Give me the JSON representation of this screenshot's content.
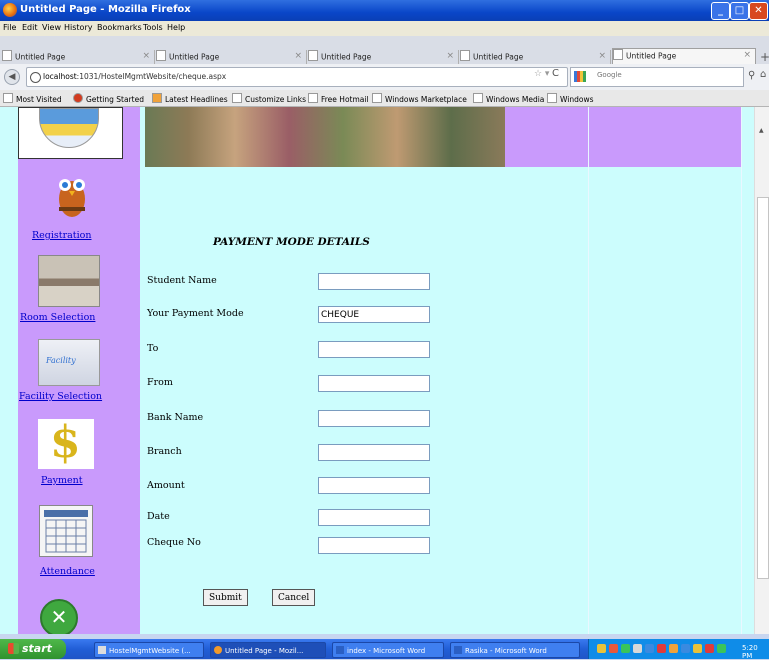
{
  "window": {
    "title": "Untitled Page - Mozilla Firefox"
  },
  "menu": [
    "File",
    "Edit",
    "View",
    "History",
    "Bookmarks",
    "Tools",
    "Help"
  ],
  "tabs": [
    {
      "label": "Untitled Page",
      "active": false
    },
    {
      "label": "Untitled Page",
      "active": false
    },
    {
      "label": "Untitled Page",
      "active": false
    },
    {
      "label": "Untitled Page",
      "active": true
    }
  ],
  "address": {
    "host": "localhost",
    "path": ":1031/HostelMgmtWebsite/cheque.aspx"
  },
  "search": {
    "placeholder": "Google"
  },
  "bookmarks": [
    "Most Visited",
    "Getting Started",
    "Latest Headlines",
    "Customize Links",
    "Free Hotmail",
    "Windows Marketplace",
    "Windows Media",
    "Windows"
  ],
  "sidebar": {
    "items": [
      {
        "label": "Registration",
        "icon": "owl-icon"
      },
      {
        "label": "Room Selection",
        "icon": "room-photo-icon"
      },
      {
        "label": "Facility Selection",
        "icon": "facility-icon"
      },
      {
        "label": "Payment",
        "icon": "dollar-icon"
      },
      {
        "label": "Attendance",
        "icon": "calendar-icon"
      }
    ]
  },
  "form": {
    "title": "PAYMENT MODE DETAILS",
    "fields": [
      {
        "label": "Student Name",
        "value": ""
      },
      {
        "label": "Your Payment Mode",
        "value": "CHEQUE"
      },
      {
        "label": "To",
        "value": ""
      },
      {
        "label": "From",
        "value": ""
      },
      {
        "label": "Bank Name",
        "value": ""
      },
      {
        "label": "Branch",
        "value": ""
      },
      {
        "label": "Amount",
        "value": ""
      },
      {
        "label": "Date",
        "value": ""
      },
      {
        "label": "Cheque No",
        "value": ""
      }
    ],
    "submit_label": "Submit",
    "cancel_label": "Cancel"
  },
  "taskbar": {
    "start_label": "start",
    "tasks": [
      "HostelMgmtWebsite (...",
      "Untitled Page - Mozil...",
      "index - Microsoft Word",
      "Rasika - Microsoft Word"
    ],
    "clock": "5:20 PM"
  },
  "colors": {
    "page_bg": "#ccfdfd",
    "sidebar": "#c99afc",
    "link": "#0000cc",
    "titlebar": "#0a46c8"
  }
}
